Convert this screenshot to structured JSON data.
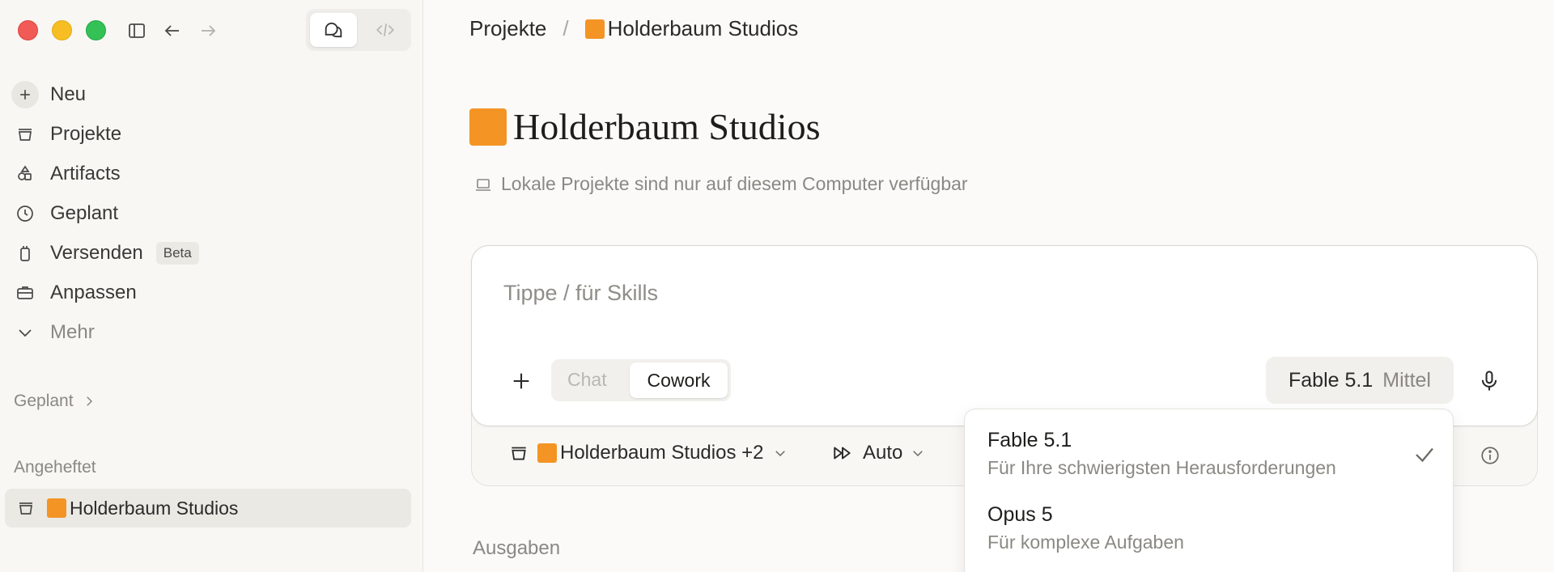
{
  "sidebar": {
    "items": [
      {
        "label": "Neu",
        "icon": "plus-icon"
      },
      {
        "label": "Projekte",
        "icon": "projects-icon"
      },
      {
        "label": "Artifacts",
        "icon": "artifacts-icon"
      },
      {
        "label": "Geplant",
        "icon": "clock-icon"
      },
      {
        "label": "Versenden",
        "icon": "device-icon",
        "badge": "Beta"
      },
      {
        "label": "Anpassen",
        "icon": "briefcase-icon"
      },
      {
        "label": "Mehr",
        "icon": "chevron-down-icon"
      }
    ],
    "scheduled_label": "Geplant",
    "pinned_label": "Angeheftet",
    "pinned_item": "Holderbaum Studios"
  },
  "breadcrumb": {
    "root": "Projekte",
    "separator": "/",
    "current": "Holderbaum Studios"
  },
  "page": {
    "title": "Holderbaum Studios",
    "subtitle": "Lokale Projekte sind nur auf diesem Computer verfügbar"
  },
  "composer": {
    "placeholder": "Tippe / für Skills",
    "mode_chat": "Chat",
    "mode_cowork": "Cowork",
    "model_name": "Fable 5.1",
    "model_level": "Mittel",
    "project_selector": "Holderbaum Studios +2",
    "auto_label": "Auto"
  },
  "dropdown": {
    "options": [
      {
        "name": "Fable 5.1",
        "description": "Für Ihre schwierigsten Herausforderungen",
        "selected": true
      },
      {
        "name": "Opus 5",
        "description": "Für komplexe Aufgaben",
        "selected": false
      }
    ]
  },
  "outputs_label": "Ausgaben",
  "colors": {
    "accent_orange": "#f39425",
    "traffic_red": "#f15a55",
    "traffic_yellow": "#f7be23",
    "traffic_green": "#34c155"
  }
}
